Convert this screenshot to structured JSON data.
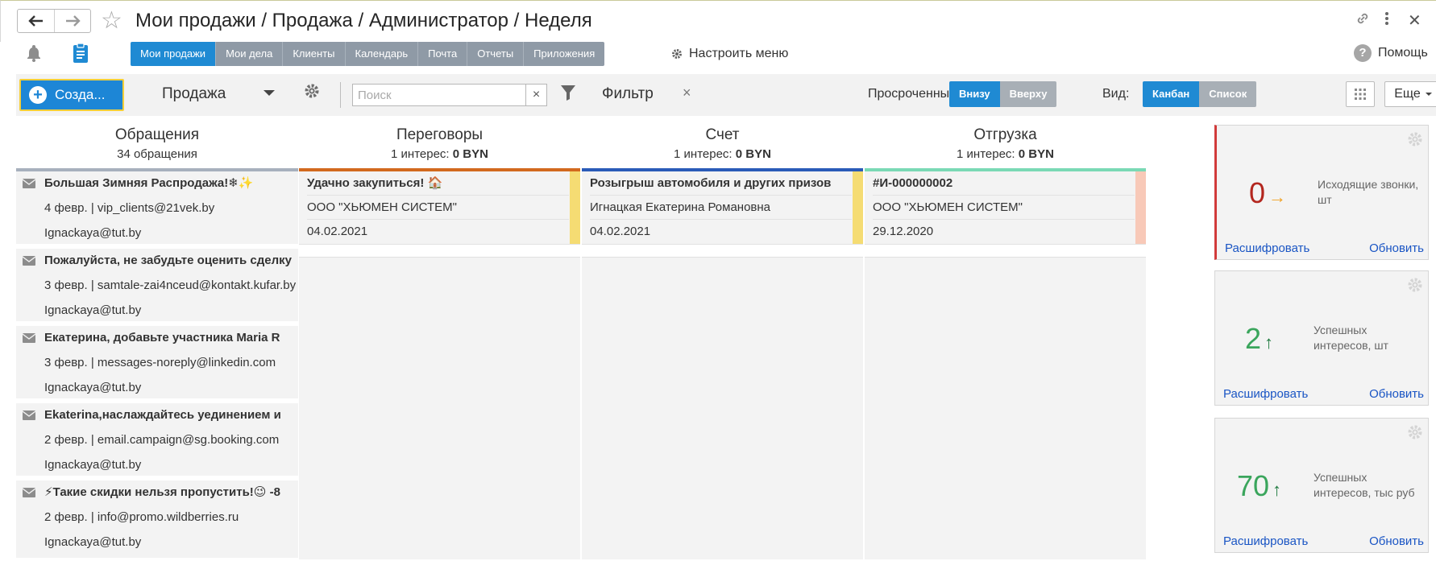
{
  "window": {
    "title": "Мои продажи / Продажа / Администратор / Неделя"
  },
  "sections": [
    {
      "label": "Мои продажи",
      "active": true
    },
    {
      "label": "Мои дела",
      "active": false
    },
    {
      "label": "Клиенты",
      "active": false
    },
    {
      "label": "Календарь",
      "active": false
    },
    {
      "label": "Почта",
      "active": false
    },
    {
      "label": "Отчеты",
      "active": false
    },
    {
      "label": "Приложения",
      "active": false
    }
  ],
  "customize_menu_label": "Настроить меню",
  "help_label": "Помощь",
  "toolbar": {
    "create_label": "Созда...",
    "stage_value": "Продажа",
    "search_placeholder": "Поиск",
    "search_clear": "×",
    "filter_label": "Фильтр",
    "filter_clear": "×",
    "overdue_label": "Просроченные:",
    "overdue_options": [
      {
        "label": "Внизу",
        "active": true
      },
      {
        "label": "Вверху",
        "active": false
      }
    ],
    "view_label": "Вид:",
    "view_options": [
      {
        "label": "Канбан",
        "active": true
      },
      {
        "label": "Список",
        "active": false
      }
    ],
    "more_label": "Еще"
  },
  "columns": [
    {
      "title": "Обращения",
      "subtitle": "34 обращения",
      "line_color": "#a7b0bd",
      "cards": [
        {
          "title": "Большая Зимняя Распродажа!❄✨",
          "line2": "4 февр. | vip_clients@21vek.by",
          "line3": "Ignackaya@tut.by"
        },
        {
          "title": "Пожалуйста, не забудьте оценить сделку",
          "line2": "3 февр. | samtale-zai4nceud@kontakt.kufar.by",
          "line3": "Ignackaya@tut.by"
        },
        {
          "title": "Екатерина, добавьте участника Maria R",
          "line2": "3 февр. | messages-noreply@linkedin.com",
          "line3": "Ignackaya@tut.by"
        },
        {
          "title": "Ekaterina,наслаждайтесь уединением и",
          "line2": "2 февр. | email.campaign@sg.booking.com",
          "line3": "Ignackaya@tut.by"
        },
        {
          "title": "⚡Такие скидки нельзя пропустить!😉 -8",
          "line2": "2 февр. | info@promo.wildberries.ru",
          "line3": "Ignackaya@tut.by"
        }
      ]
    },
    {
      "title": "Переговоры",
      "subtitle_prefix": "1 интерес:",
      "subtitle_value": "0 BYN",
      "line_color": "#d2691e",
      "cards": [
        {
          "title": "Удачно закупиться! 🏠",
          "line2": "ООО \"ХЬЮМЕН СИСТЕМ\"",
          "line3": "04.02.2021",
          "stripe": "#f5dc73"
        }
      ]
    },
    {
      "title": "Счет",
      "subtitle_prefix": "1 интерес:",
      "subtitle_value": "0 BYN",
      "line_color": "#2a5bb8",
      "cards": [
        {
          "title": "Розыгрыш автомобиля и других призов",
          "line2": "Игнацкая Екатерина Романовна",
          "line3": "04.02.2021",
          "stripe": "#f5dc73"
        }
      ]
    },
    {
      "title": "Отгрузка",
      "subtitle_prefix": "1 интерес:",
      "subtitle_value": "0 BYN",
      "line_color": "#7ad9b5",
      "cards": [
        {
          "title": "#И-000000002",
          "line2": "ООО \"ХЬЮМЕН СИСТЕМ\"",
          "line3": "29.12.2020",
          "stripe": "#f8c9b8"
        }
      ]
    }
  ],
  "widgets": [
    {
      "value": "0",
      "arrow": "→",
      "value_color": "#b3261e",
      "arrow_color": "#f0a020",
      "desc": "Исходящие звонки, шт",
      "link_left": "Расшифровать",
      "link_right": "Обновить"
    },
    {
      "value": "2",
      "arrow": "↑",
      "value_color": "#3aa55c",
      "arrow_color": "#1f7a3f",
      "desc": "Успешных интересов, шт",
      "link_left": "Расшифровать",
      "link_right": "Обновить"
    },
    {
      "value": "70",
      "arrow": "↑",
      "value_color": "#3aa55c",
      "arrow_color": "#1f7a3f",
      "desc": "Успешных интересов, тыс руб",
      "link_left": "Расшифровать",
      "link_right": "Обновить"
    }
  ]
}
